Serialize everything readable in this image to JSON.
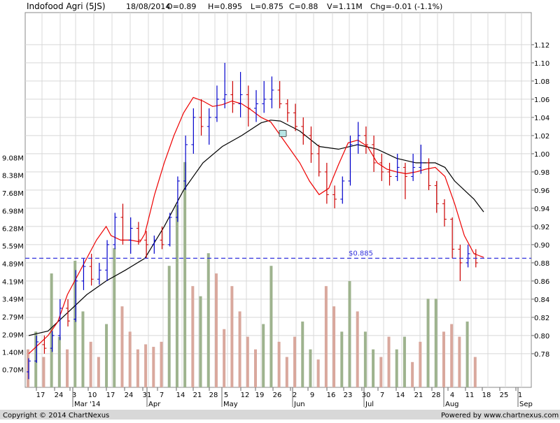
{
  "header": {
    "title": "Indofood Agri (5JS)",
    "date": "18/08/2014",
    "open": "O=0.89",
    "high": "H=0.895",
    "low": "L=0.875",
    "close": "C=0.88",
    "volume": "V=1.11M",
    "change": "Chg=-0.01 (-1.1%)"
  },
  "footer": {
    "copyright": "Copyright © 2014 ChartNexus",
    "powered": "Powered by www.chartnexus.com"
  },
  "chart_data": {
    "type": "ohlc_bar_with_volume",
    "price_axis": {
      "ticks": [
        0.78,
        0.8,
        0.82,
        0.84,
        0.86,
        0.88,
        0.9,
        0.92,
        0.94,
        0.96,
        0.98,
        1.0,
        1.02,
        1.04,
        1.06,
        1.08,
        1.1,
        1.12
      ],
      "tick_labels": [
        "0.78",
        "0.80",
        "0.82",
        "0.84",
        "0.86",
        "0.88",
        "0.90",
        "0.92",
        "0.94",
        "0.96",
        "0.98",
        "1.00",
        "1.02",
        "1.04",
        "1.06",
        "1.08",
        "1.10",
        "1.12"
      ],
      "range": [
        0.743,
        1.12
      ]
    },
    "volume_axis": {
      "unit": "M",
      "ticks": [
        0.7,
        1.4,
        2.09,
        2.79,
        3.49,
        4.19,
        4.89,
        5.59,
        6.28,
        6.98,
        7.68,
        8.38,
        9.08
      ],
      "tick_labels": [
        "0.70M",
        "1.40M",
        "2.09M",
        "2.79M",
        "3.49M",
        "4.19M",
        "4.89M",
        "5.59M",
        "6.28M",
        "6.98M",
        "7.68M",
        "8.38M",
        "9.08M"
      ]
    },
    "reference_line": {
      "value": 0.885,
      "label": "$0.885",
      "color": "#3333dd",
      "style": "dashed"
    },
    "x_axis": {
      "day_labels": [
        "17",
        "24",
        "3",
        "10",
        "17",
        "24",
        "31",
        "7",
        "14",
        "21",
        "28",
        "5",
        "12",
        "19",
        "26",
        "2",
        "9",
        "16",
        "23",
        "30",
        "7",
        "14",
        "21",
        "28",
        "4",
        "11",
        "18",
        "25",
        "1"
      ],
      "month_labels": [
        "Mar '14",
        "Apr",
        "May",
        "Jun",
        "Jul",
        "Aug",
        "Sep"
      ]
    },
    "colors": {
      "bar_up": "#0000cc",
      "bar_down": "#cc0000",
      "ma_short": "#ee0000",
      "ma_long": "#000000",
      "volume_up": "#9eb38e",
      "volume_down": "#d9a89d",
      "grid": "#d8d8d8"
    },
    "moving_average_short": [
      [
        0,
        0.78
      ],
      [
        4,
        0.79
      ],
      [
        8,
        0.8
      ],
      [
        12,
        0.815
      ],
      [
        16,
        0.845
      ],
      [
        20,
        0.865
      ],
      [
        24,
        0.885
      ],
      [
        28,
        0.905
      ],
      [
        32,
        0.92
      ],
      [
        34,
        0.91
      ],
      [
        38,
        0.905
      ],
      [
        42,
        0.905
      ],
      [
        46,
        0.903
      ],
      [
        48,
        0.912
      ],
      [
        52,
        0.955
      ],
      [
        56,
        0.99
      ],
      [
        60,
        1.02
      ],
      [
        64,
        1.045
      ],
      [
        68,
        1.062
      ],
      [
        72,
        1.058
      ],
      [
        76,
        1.052
      ],
      [
        80,
        1.054
      ],
      [
        84,
        1.058
      ],
      [
        88,
        1.055
      ],
      [
        92,
        1.048
      ],
      [
        96,
        1.04
      ],
      [
        100,
        1.035
      ],
      [
        104,
        1.02
      ],
      [
        108,
        1.005
      ],
      [
        112,
        0.99
      ],
      [
        116,
        0.97
      ],
      [
        120,
        0.955
      ],
      [
        124,
        0.962
      ],
      [
        128,
        0.988
      ],
      [
        132,
        1.012
      ],
      [
        136,
        1.015
      ],
      [
        140,
        1.008
      ],
      [
        144,
        0.99
      ],
      [
        148,
        0.983
      ],
      [
        152,
        0.98
      ],
      [
        156,
        0.978
      ],
      [
        160,
        0.98
      ],
      [
        164,
        0.983
      ],
      [
        168,
        0.985
      ],
      [
        172,
        0.975
      ],
      [
        176,
        0.945
      ],
      [
        180,
        0.91
      ],
      [
        184,
        0.89
      ],
      [
        186,
        0.888
      ],
      [
        188,
        0.886
      ]
    ],
    "moving_average_long": [
      [
        0,
        0.8
      ],
      [
        8,
        0.805
      ],
      [
        16,
        0.825
      ],
      [
        24,
        0.845
      ],
      [
        32,
        0.86
      ],
      [
        40,
        0.872
      ],
      [
        48,
        0.885
      ],
      [
        56,
        0.92
      ],
      [
        64,
        0.96
      ],
      [
        72,
        0.99
      ],
      [
        80,
        1.008
      ],
      [
        88,
        1.02
      ],
      [
        96,
        1.034
      ],
      [
        100,
        1.037
      ],
      [
        104,
        1.036
      ],
      [
        112,
        1.025
      ],
      [
        120,
        1.008
      ],
      [
        128,
        1.005
      ],
      [
        136,
        1.01
      ],
      [
        144,
        1.005
      ],
      [
        152,
        0.995
      ],
      [
        160,
        0.99
      ],
      [
        168,
        0.99
      ],
      [
        172,
        0.985
      ],
      [
        176,
        0.97
      ],
      [
        184,
        0.95
      ],
      [
        188,
        0.936
      ]
    ],
    "ohlc_bars": [
      {
        "o": 0.76,
        "h": 0.775,
        "l": 0.752,
        "c": 0.772
      },
      {
        "o": 0.772,
        "h": 0.8,
        "l": 0.77,
        "c": 0.793
      },
      {
        "o": 0.79,
        "h": 0.8,
        "l": 0.78,
        "c": 0.786
      },
      {
        "o": 0.786,
        "h": 0.805,
        "l": 0.782,
        "c": 0.8
      },
      {
        "o": 0.8,
        "h": 0.84,
        "l": 0.795,
        "c": 0.83
      },
      {
        "o": 0.83,
        "h": 0.84,
        "l": 0.81,
        "c": 0.816
      },
      {
        "o": 0.818,
        "h": 0.872,
        "l": 0.815,
        "c": 0.86
      },
      {
        "o": 0.86,
        "h": 0.885,
        "l": 0.85,
        "c": 0.876
      },
      {
        "o": 0.876,
        "h": 0.89,
        "l": 0.855,
        "c": 0.862
      },
      {
        "o": 0.862,
        "h": 0.88,
        "l": 0.856,
        "c": 0.872
      },
      {
        "o": 0.872,
        "h": 0.905,
        "l": 0.86,
        "c": 0.9
      },
      {
        "o": 0.9,
        "h": 0.935,
        "l": 0.895,
        "c": 0.93
      },
      {
        "o": 0.93,
        "h": 0.945,
        "l": 0.9,
        "c": 0.905
      },
      {
        "o": 0.905,
        "h": 0.93,
        "l": 0.89,
        "c": 0.918
      },
      {
        "o": 0.918,
        "h": 0.925,
        "l": 0.9,
        "c": 0.905
      },
      {
        "o": 0.905,
        "h": 0.915,
        "l": 0.885,
        "c": 0.9
      },
      {
        "o": 0.9,
        "h": 0.91,
        "l": 0.89,
        "c": 0.905
      },
      {
        "o": 0.905,
        "h": 0.92,
        "l": 0.895,
        "c": 0.9
      },
      {
        "o": 0.9,
        "h": 0.935,
        "l": 0.898,
        "c": 0.93
      },
      {
        "o": 0.93,
        "h": 0.975,
        "l": 0.925,
        "c": 0.97
      },
      {
        "o": 0.97,
        "h": 1.02,
        "l": 0.96,
        "c": 1.01
      },
      {
        "o": 1.01,
        "h": 1.05,
        "l": 1.0,
        "c": 1.04
      },
      {
        "o": 1.04,
        "h": 1.06,
        "l": 1.02,
        "c": 1.03
      },
      {
        "o": 1.03,
        "h": 1.05,
        "l": 1.01,
        "c": 1.04
      },
      {
        "o": 1.04,
        "h": 1.075,
        "l": 1.035,
        "c": 1.06
      },
      {
        "o": 1.06,
        "h": 1.1,
        "l": 1.05,
        "c": 1.065
      },
      {
        "o": 1.065,
        "h": 1.08,
        "l": 1.045,
        "c": 1.055
      },
      {
        "o": 1.055,
        "h": 1.09,
        "l": 1.04,
        "c": 1.065
      },
      {
        "o": 1.065,
        "h": 1.075,
        "l": 1.03,
        "c": 1.05
      },
      {
        "o": 1.05,
        "h": 1.07,
        "l": 1.035,
        "c": 1.055
      },
      {
        "o": 1.055,
        "h": 1.08,
        "l": 1.045,
        "c": 1.06
      },
      {
        "o": 1.06,
        "h": 1.085,
        "l": 1.05,
        "c": 1.07
      },
      {
        "o": 1.07,
        "h": 1.08,
        "l": 1.05,
        "c": 1.055
      },
      {
        "o": 1.055,
        "h": 1.06,
        "l": 1.035,
        "c": 1.045
      },
      {
        "o": 1.045,
        "h": 1.055,
        "l": 1.025,
        "c": 1.03
      },
      {
        "o": 1.03,
        "h": 1.04,
        "l": 1.01,
        "c": 1.02
      },
      {
        "o": 1.02,
        "h": 1.03,
        "l": 0.99,
        "c": 1.0
      },
      {
        "o": 1.0,
        "h": 1.01,
        "l": 0.975,
        "c": 0.98
      },
      {
        "o": 0.98,
        "h": 0.99,
        "l": 0.945,
        "c": 0.955
      },
      {
        "o": 0.955,
        "h": 0.965,
        "l": 0.94,
        "c": 0.95
      },
      {
        "o": 0.95,
        "h": 0.975,
        "l": 0.945,
        "c": 0.97
      },
      {
        "o": 0.97,
        "h": 1.02,
        "l": 0.965,
        "c": 1.01
      },
      {
        "o": 1.01,
        "h": 1.035,
        "l": 1.0,
        "c": 1.02
      },
      {
        "o": 1.02,
        "h": 1.03,
        "l": 1.0,
        "c": 1.01
      },
      {
        "o": 1.01,
        "h": 1.02,
        "l": 0.98,
        "c": 0.99
      },
      {
        "o": 0.99,
        "h": 1.0,
        "l": 0.97,
        "c": 0.98
      },
      {
        "o": 0.98,
        "h": 0.99,
        "l": 0.965,
        "c": 0.975
      },
      {
        "o": 0.975,
        "h": 1.0,
        "l": 0.97,
        "c": 0.985
      },
      {
        "o": 0.985,
        "h": 0.99,
        "l": 0.95,
        "c": 0.975
      },
      {
        "o": 0.975,
        "h": 1.0,
        "l": 0.97,
        "c": 0.985
      },
      {
        "o": 0.985,
        "h": 1.01,
        "l": 0.978,
        "c": 0.99
      },
      {
        "o": 0.99,
        "h": 0.995,
        "l": 0.96,
        "c": 0.965
      },
      {
        "o": 0.965,
        "h": 0.97,
        "l": 0.935,
        "c": 0.945
      },
      {
        "o": 0.945,
        "h": 0.95,
        "l": 0.92,
        "c": 0.928
      },
      {
        "o": 0.928,
        "h": 0.93,
        "l": 0.885,
        "c": 0.895
      },
      {
        "o": 0.895,
        "h": 0.9,
        "l": 0.86,
        "c": 0.88
      },
      {
        "o": 0.88,
        "h": 0.9,
        "l": 0.875,
        "c": 0.89
      },
      {
        "o": 0.89,
        "h": 0.895,
        "l": 0.875,
        "c": 0.88
      }
    ],
    "volume_bars": [
      {
        "v": 1.5,
        "up": false
      },
      {
        "v": 2.2,
        "up": true
      },
      {
        "v": 1.2,
        "up": false
      },
      {
        "v": 4.5,
        "up": true
      },
      {
        "v": 2.0,
        "up": true
      },
      {
        "v": 1.5,
        "up": false
      },
      {
        "v": 5.0,
        "up": true
      },
      {
        "v": 3.0,
        "up": true
      },
      {
        "v": 1.8,
        "up": false
      },
      {
        "v": 1.2,
        "up": false
      },
      {
        "v": 2.5,
        "up": true
      },
      {
        "v": 5.5,
        "up": true
      },
      {
        "v": 3.2,
        "up": false
      },
      {
        "v": 2.2,
        "up": false
      },
      {
        "v": 1.5,
        "up": false
      },
      {
        "v": 1.7,
        "up": false
      },
      {
        "v": 1.6,
        "up": false
      },
      {
        "v": 1.8,
        "up": false
      },
      {
        "v": 4.8,
        "up": true
      },
      {
        "v": 7.2,
        "up": true
      },
      {
        "v": 8.9,
        "up": true
      },
      {
        "v": 4.0,
        "up": false
      },
      {
        "v": 3.6,
        "up": true
      },
      {
        "v": 5.3,
        "up": true
      },
      {
        "v": 4.5,
        "up": false
      },
      {
        "v": 2.3,
        "up": false
      },
      {
        "v": 4.0,
        "up": false
      },
      {
        "v": 3.0,
        "up": false
      },
      {
        "v": 2.0,
        "up": false
      },
      {
        "v": 1.5,
        "up": false
      },
      {
        "v": 2.5,
        "up": true
      },
      {
        "v": 4.8,
        "up": true
      },
      {
        "v": 1.8,
        "up": false
      },
      {
        "v": 1.2,
        "up": false
      },
      {
        "v": 2.0,
        "up": false
      },
      {
        "v": 2.6,
        "up": true
      },
      {
        "v": 1.5,
        "up": true
      },
      {
        "v": 1.1,
        "up": false
      },
      {
        "v": 4.0,
        "up": false
      },
      {
        "v": 3.2,
        "up": false
      },
      {
        "v": 2.2,
        "up": true
      },
      {
        "v": 4.2,
        "up": true
      },
      {
        "v": 3.0,
        "up": false
      },
      {
        "v": 2.2,
        "up": true
      },
      {
        "v": 1.5,
        "up": true
      },
      {
        "v": 1.2,
        "up": false
      },
      {
        "v": 2.0,
        "up": false
      },
      {
        "v": 1.5,
        "up": true
      },
      {
        "v": 2.0,
        "up": true
      },
      {
        "v": 1.0,
        "up": false
      },
      {
        "v": 1.8,
        "up": false
      },
      {
        "v": 3.5,
        "up": true
      },
      {
        "v": 3.5,
        "up": true
      },
      {
        "v": 2.2,
        "up": false
      },
      {
        "v": 2.5,
        "up": false
      },
      {
        "v": 2.0,
        "up": false
      },
      {
        "v": 2.6,
        "up": true
      },
      {
        "v": 1.2,
        "up": false
      }
    ]
  }
}
